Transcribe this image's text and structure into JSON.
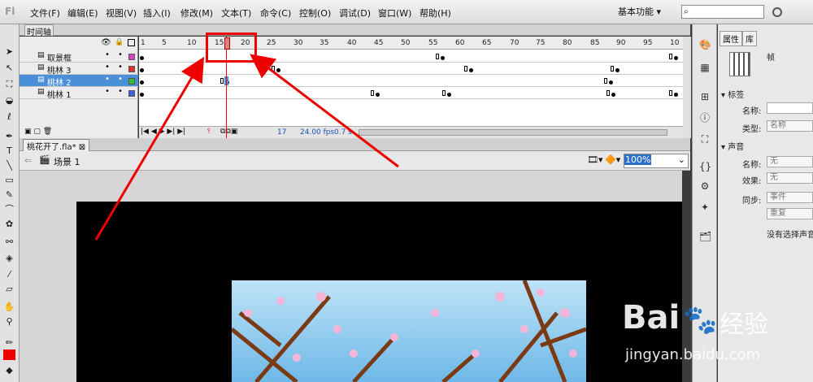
{
  "app_logo": "Fl",
  "menu": [
    "文件(F)",
    "编辑(E)",
    "视图(V)",
    "插入(I)",
    "修改(M)",
    "文本(T)",
    "命令(C)",
    "控制(O)",
    "调试(D)",
    "窗口(W)",
    "帮助(H)"
  ],
  "workspace": "基本功能",
  "timeline": {
    "tab_label": "时间轴",
    "ruler": [
      "1",
      "5",
      "10",
      "15",
      "20",
      "25",
      "30",
      "35",
      "40",
      "45",
      "50",
      "55",
      "60",
      "65",
      "70",
      "75",
      "80",
      "85",
      "90",
      "95",
      "10"
    ],
    "layers": [
      {
        "name": "取景框",
        "color": "#e040c0"
      },
      {
        "name": "桃林 3",
        "color": "#e03030"
      },
      {
        "name": "桃林 2",
        "color": "#30c030"
      },
      {
        "name": "桃林 1",
        "color": "#4060e0"
      }
    ],
    "footer": {
      "frame": "17",
      "fps": "24.00",
      "fps_unit": "fps",
      "time": "0.7 s"
    }
  },
  "document": {
    "tab_label": "桃花开了.fla*",
    "scene_label": "场景 1",
    "zoom": "100%"
  },
  "properties": {
    "tabs": [
      "属性",
      "库"
    ],
    "type_label": "帧",
    "section_label": "标签",
    "name_label": "名称:",
    "type_label2": "类型:",
    "type_value": "名称",
    "sound_section": "声音",
    "sound_name_label": "名称:",
    "sound_name_value": "无",
    "effect_label": "效果:",
    "effect_value": "无",
    "sync_label": "同步:",
    "sync_value": "事件",
    "repeat_value": "重复",
    "no_sound": "没有选择声音"
  },
  "watermark": {
    "brand": "Bai",
    "brand2": "经验",
    "url": "jingyan.baidu.com"
  },
  "colors": {
    "accent": "#e00000",
    "selected_layer": "#4a8fd8"
  }
}
